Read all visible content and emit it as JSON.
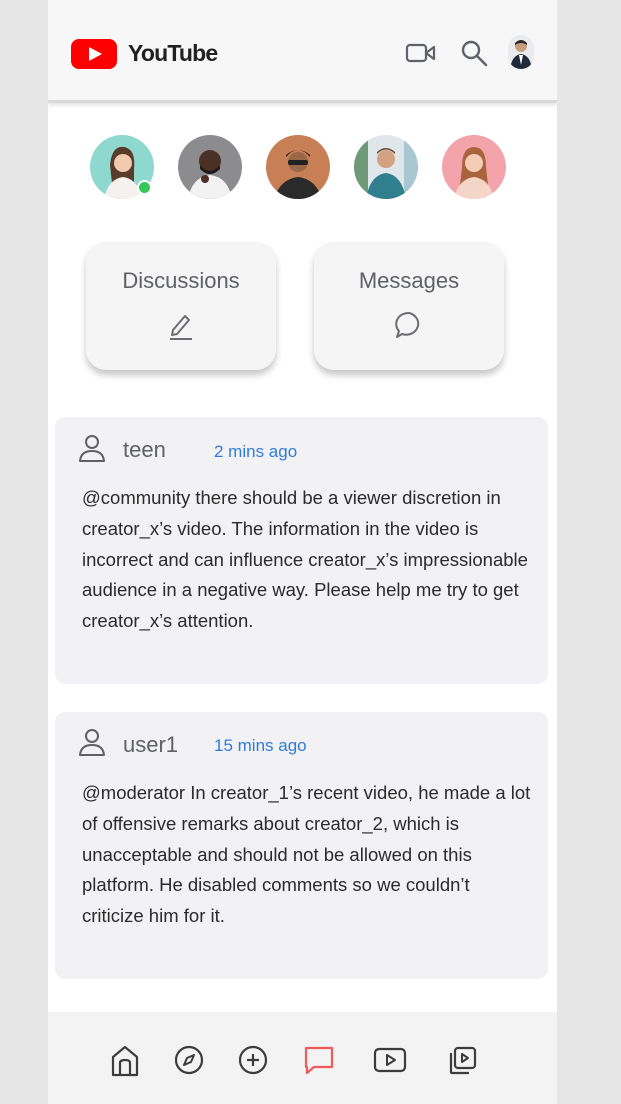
{
  "app": {
    "title": "YouTube"
  },
  "header": {
    "logo_icon": "youtube-play-logo",
    "actions": [
      "video-camera-icon",
      "search-icon",
      "avatar"
    ]
  },
  "stories": [
    {
      "name": "story-avatar-1",
      "online": true
    },
    {
      "name": "story-avatar-2",
      "online": false
    },
    {
      "name": "story-avatar-3",
      "online": false
    },
    {
      "name": "story-avatar-4",
      "online": false
    },
    {
      "name": "story-avatar-5",
      "online": false
    }
  ],
  "cards": {
    "discussions": {
      "label": "Discussions",
      "icon": "pencil-icon"
    },
    "messages": {
      "label": "Messages",
      "icon": "chat-bubble-icon"
    }
  },
  "posts": [
    {
      "user": "teen",
      "time": "2 mins ago",
      "body": "@community there should be a viewer discretion in creator_x’s video. The information in the video is incorrect and can influence creator_x’s impressionable audience in a negative way. Please help me try to get creator_x’s attention."
    },
    {
      "user": "user1",
      "time": "15 mins ago",
      "body": "@moderator In creator_1’s recent video, he made a lot of offensive remarks about creator_2, which is unacceptable and should not be allowed on this platform. He disabled comments so we couldn’t criticize him for it."
    }
  ],
  "bottom_nav": {
    "items": [
      "home-icon",
      "explore-compass-icon",
      "add-circle-icon",
      "chat-icon",
      "video-play-icon",
      "library-icon"
    ],
    "active": "chat-icon"
  },
  "colors": {
    "brand_red": "#ff0000",
    "time_blue": "#2f7bdc",
    "online_green": "#34c759",
    "active_nav": "#f05a5a",
    "post_bg": "#f2f2f4"
  }
}
